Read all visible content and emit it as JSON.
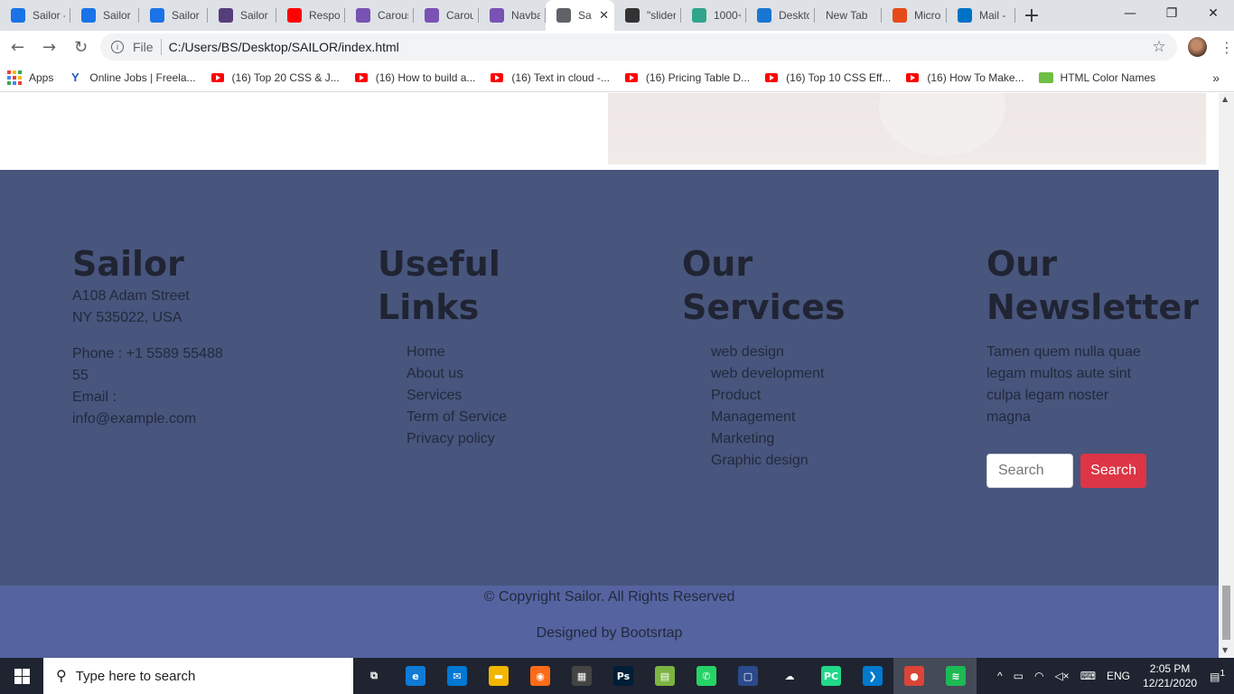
{
  "browser": {
    "tabs": [
      {
        "label": "Sailor -",
        "icon": "sailor-logo-icon",
        "color": "#1a73e8"
      },
      {
        "label": "Sailor -",
        "icon": "sailor-logo-icon",
        "color": "#1a73e8"
      },
      {
        "label": "Sailor |",
        "icon": "sailor-logo-icon",
        "color": "#1a73e8"
      },
      {
        "label": "Sailor |",
        "icon": "bootstrap-icon",
        "color": "#563d7c"
      },
      {
        "label": "Respor",
        "icon": "youtube-icon",
        "color": "#ff0000"
      },
      {
        "label": "Carous",
        "icon": "bootstrap-icon",
        "color": "#7952b3"
      },
      {
        "label": "Carous",
        "icon": "bootstrap-icon",
        "color": "#7952b3"
      },
      {
        "label": "Navba",
        "icon": "bootstrap-icon",
        "color": "#7952b3"
      },
      {
        "label": "Sai",
        "icon": "globe-icon",
        "color": "#5f6368",
        "active": true
      },
      {
        "label": "\"slider",
        "icon": "eye-icon",
        "color": "#333"
      },
      {
        "label": "1000+",
        "icon": "d-icon",
        "color": "#30a58b"
      },
      {
        "label": "Deskto",
        "icon": "flag-icon",
        "color": "#1976d2"
      },
      {
        "label": "New Tab",
        "icon": "",
        "color": ""
      },
      {
        "label": "Micros",
        "icon": "office-icon",
        "color": "#e64a19"
      },
      {
        "label": "Mail -",
        "icon": "outlook-icon",
        "color": "#0072c6"
      }
    ],
    "close_glyph": "✕",
    "new_tab_glyph": "+",
    "window_controls": {
      "minimize": "—",
      "restore": "❐",
      "close": "✕"
    },
    "address": {
      "scheme_label": "File",
      "url": "C:/Users/BS/Desktop/SAILOR/index.html"
    },
    "nav": {
      "back": "←",
      "forward": "→",
      "reload": "↻",
      "info": "i",
      "star": "☆",
      "menu": "⋮"
    },
    "bookmarks": [
      {
        "label": "Apps",
        "icon": "apps-grid-icon"
      },
      {
        "label": "Online Jobs | Freela...",
        "icon": "upwork-icon"
      },
      {
        "label": "(16) Top 20 CSS & J...",
        "icon": "youtube-icon"
      },
      {
        "label": "(16) How to build a...",
        "icon": "youtube-icon"
      },
      {
        "label": "(16) Text in cloud -...",
        "icon": "youtube-icon"
      },
      {
        "label": "(16) Pricing Table D...",
        "icon": "youtube-icon"
      },
      {
        "label": "(16) Top 10 CSS Eff...",
        "icon": "youtube-icon"
      },
      {
        "label": "(16) How To Make...",
        "icon": "youtube-icon"
      },
      {
        "label": "HTML Color Names",
        "icon": "color-names-icon"
      }
    ],
    "bookmarks_more": "»"
  },
  "page": {
    "footer": {
      "about": {
        "title": "Sailor",
        "address_line1": "A108 Adam Street",
        "address_line2": "NY 535022, USA",
        "phone_line1": "Phone : +1 5589 55488",
        "phone_line2": "55",
        "email_label": "Email :",
        "email": "info@example.com"
      },
      "useful_links": {
        "title_line1": "Useful",
        "title_line2": "Links",
        "items": [
          "Home",
          "About us",
          "Services",
          "Term of Service",
          "Privacy policy"
        ]
      },
      "services": {
        "title_line1": "Our",
        "title_line2": "Services",
        "items": [
          "web design",
          "web development",
          "Product",
          "Management",
          "Marketing",
          "Graphic design"
        ]
      },
      "newsletter": {
        "title_line1": "Our",
        "title_line2": "Newsletter",
        "text_lines": [
          "Tamen quem nulla quae",
          "legam multos aute sint",
          "culpa legam noster",
          "magna"
        ],
        "search_placeholder": "Search",
        "search_button": "Search"
      },
      "copyright": "© Copyright Sailor. All Rights Reserved",
      "designed_by": "Designed by Bootsrtap"
    },
    "colors": {
      "footer_bg": "#48557d",
      "bottom_bg": "#5563a0",
      "button": "#dc3545"
    }
  },
  "taskbar": {
    "search_placeholder": "Type here to search",
    "apps": [
      {
        "name": "task-view-icon",
        "glyph": "⧉",
        "color": "#1f2430"
      },
      {
        "name": "edge-icon",
        "glyph": "e",
        "color": "#0f7bd6"
      },
      {
        "name": "mail-icon",
        "glyph": "✉",
        "color": "#0078d4"
      },
      {
        "name": "file-explorer-icon",
        "glyph": "▬",
        "color": "#f2b600"
      },
      {
        "name": "firefox-icon",
        "glyph": "◉",
        "color": "#ff6b1a"
      },
      {
        "name": "store-icon",
        "glyph": "▦",
        "color": "#444"
      },
      {
        "name": "photoshop-icon",
        "glyph": "Ps",
        "color": "#001e36"
      },
      {
        "name": "spreadsheet-icon",
        "glyph": "▤",
        "color": "#7cb342"
      },
      {
        "name": "whatsapp-icon",
        "glyph": "✆",
        "color": "#25d366"
      },
      {
        "name": "notepad-icon",
        "glyph": "▢",
        "color": "#2b4a8b"
      },
      {
        "name": "onedrive-icon",
        "glyph": "☁",
        "color": "#1f2430"
      },
      {
        "name": "pycharm-icon",
        "glyph": "PC",
        "color": "#21d789"
      },
      {
        "name": "vscode-icon",
        "glyph": "❯",
        "color": "#007acc"
      },
      {
        "name": "chrome-icon",
        "glyph": "●",
        "color": "#db4437"
      },
      {
        "name": "spotify-icon",
        "glyph": "≋",
        "color": "#1db954"
      }
    ],
    "tray": {
      "chevron": "^",
      "language": "ENG",
      "time": "2:05 PM",
      "date": "12/21/2020",
      "notifications": "1"
    }
  }
}
